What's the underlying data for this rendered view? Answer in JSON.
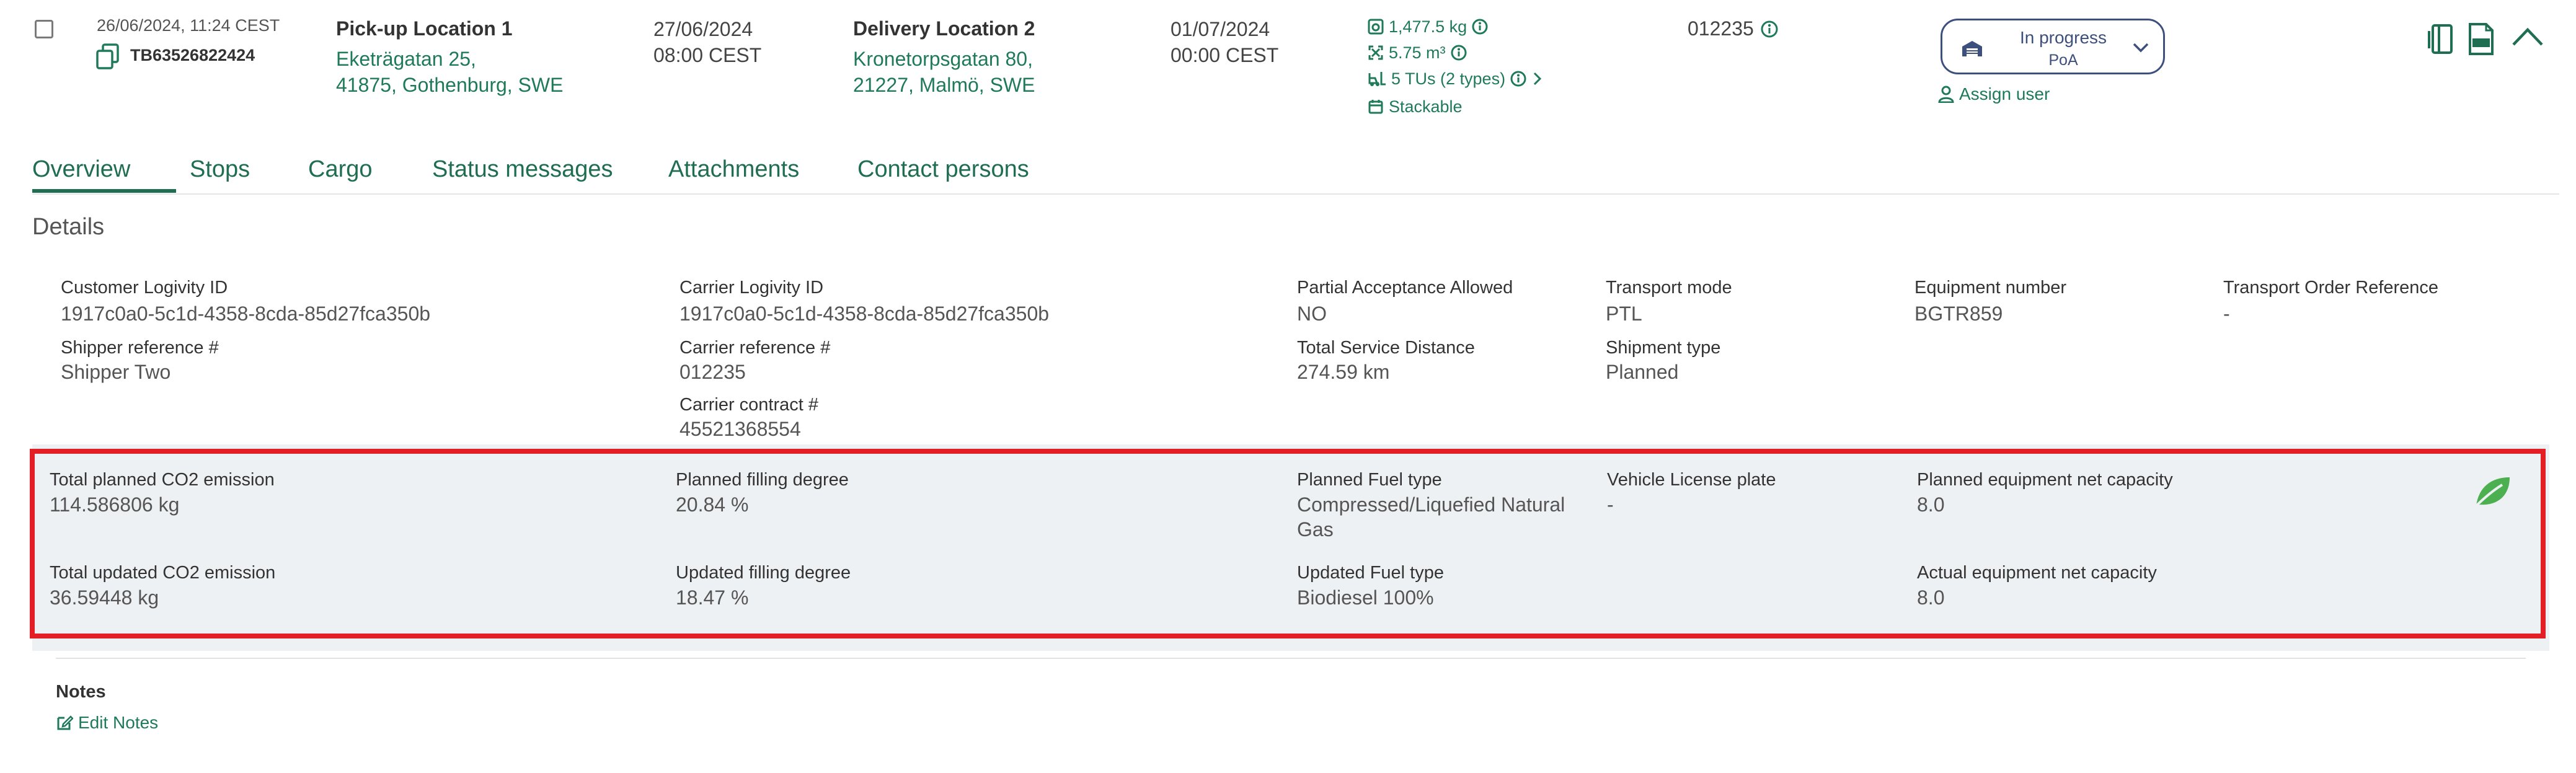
{
  "row": {
    "created": "26/06/2024, 11:24 CEST",
    "order_id": "TB63526822424",
    "pickup": {
      "name": "Pick-up Location 1",
      "address_line1": "Eketrägatan 25,",
      "address_line2": "41875, Gothenburg, SWE",
      "date": "27/06/2024",
      "time": "08:00 CEST"
    },
    "delivery": {
      "name": "Delivery Location 2",
      "address_line1": "Kronetorpsgatan 80,",
      "address_line2": "21227, Malmö, SWE",
      "date": "01/07/2024",
      "time": "00:00 CEST"
    },
    "cargo": {
      "weight": "1,477.5 kg",
      "volume": "5.75 m³",
      "tus": "5 TUs (2 types)",
      "stackable": "Stackable"
    },
    "carrier_ref": "012235",
    "status": {
      "label": "In progress",
      "sub": "PoA"
    },
    "assign_user": "Assign user"
  },
  "tabs": [
    "Overview",
    "Stops",
    "Cargo",
    "Status messages",
    "Attachments",
    "Contact persons"
  ],
  "details_title": "Details",
  "details": {
    "customer_logivity_id": {
      "label": "Customer Logivity ID",
      "value": "1917c0a0-5c1d-4358-8cda-85d27fca350b"
    },
    "shipper_reference": {
      "label": "Shipper reference #",
      "value": "Shipper Two"
    },
    "carrier_logivity_id": {
      "label": "Carrier Logivity ID",
      "value": "1917c0a0-5c1d-4358-8cda-85d27fca350b"
    },
    "carrier_reference": {
      "label": "Carrier reference #",
      "value": "012235"
    },
    "carrier_contract": {
      "label": "Carrier contract #",
      "value": "45521368554"
    },
    "partial_acceptance": {
      "label": "Partial Acceptance Allowed",
      "value": "NO"
    },
    "total_service_distance": {
      "label": "Total Service Distance",
      "value": "274.59 km"
    },
    "transport_mode": {
      "label": "Transport mode",
      "value": "PTL"
    },
    "shipment_type": {
      "label": "Shipment type",
      "value": "Planned"
    },
    "equipment_number": {
      "label": "Equipment number",
      "value": "BGTR859"
    },
    "transport_order_ref": {
      "label": "Transport Order Reference",
      "value": "-"
    }
  },
  "emissions": {
    "total_planned_co2": {
      "label": "Total planned CO2 emission",
      "value": "114.586806 kg"
    },
    "total_updated_co2": {
      "label": "Total updated CO2 emission",
      "value": "36.59448 kg"
    },
    "planned_filling": {
      "label": "Planned filling degree",
      "value": "20.84 %"
    },
    "updated_filling": {
      "label": "Updated filling degree",
      "value": "18.47 %"
    },
    "planned_fuel": {
      "label": "Planned Fuel type",
      "value_line1": "Compressed/Liquefied Natural",
      "value_line2": "Gas"
    },
    "updated_fuel": {
      "label": "Updated Fuel type",
      "value": "Biodiesel 100%"
    },
    "vehicle_plate": {
      "label": "Vehicle License plate",
      "value": "-"
    },
    "planned_capacity": {
      "label": "Planned equipment net capacity",
      "value": "8.0"
    },
    "actual_capacity": {
      "label": "Actual equipment net capacity",
      "value": "8.0"
    }
  },
  "notes": {
    "label": "Notes",
    "edit": "Edit Notes"
  },
  "colors": {
    "accent_green": "#1f7a5a",
    "status_blue": "#3d4f7c",
    "highlight_red": "#e31e24",
    "leaf_green": "#4caf50"
  }
}
